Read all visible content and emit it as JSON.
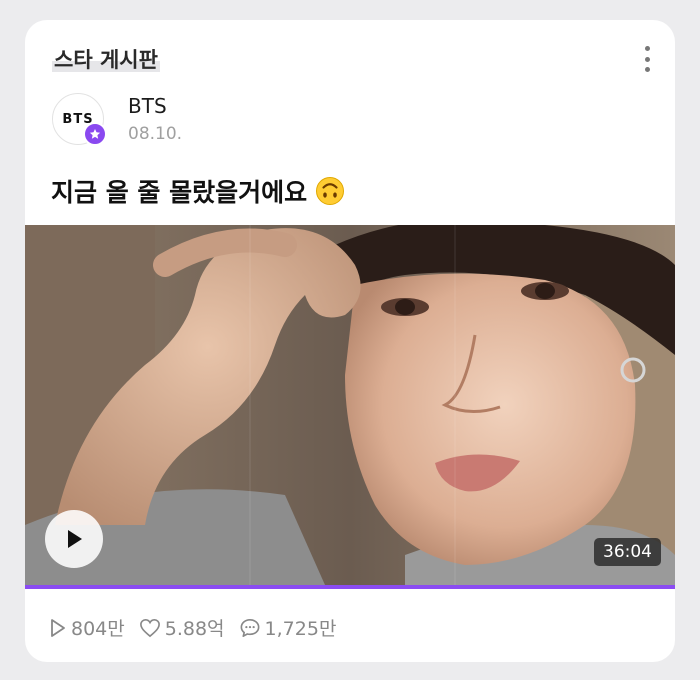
{
  "board": {
    "title": "스타 게시판"
  },
  "post": {
    "author": "BTS",
    "avatar_text": "BTS",
    "date": "08.10.",
    "title": "지금 올 줄 몰랐을거에요",
    "title_emoji": "upside-down-face-emoji"
  },
  "video": {
    "duration": "36:04",
    "progress": 1.0
  },
  "stats": {
    "plays": "804만",
    "likes": "5.88억",
    "comments": "1,725만"
  },
  "colors": {
    "accent": "#8b4cf2",
    "badge": "#8a49f0",
    "background": "#ececee",
    "card": "#ffffff"
  },
  "icons": [
    "more-vertical-icon",
    "star-badge-icon",
    "play-icon",
    "play-outline-icon",
    "heart-icon",
    "comment-icon"
  ]
}
